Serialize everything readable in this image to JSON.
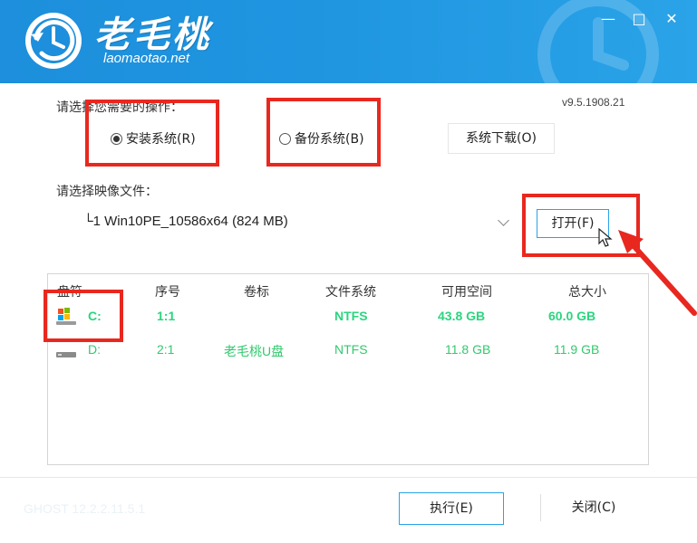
{
  "header": {
    "brand_name": "老毛桃",
    "brand_url": "laomaotao.net",
    "window_buttons": {
      "minimize": "—",
      "maximize": "□",
      "close": "✕"
    }
  },
  "operation": {
    "label": "请选择您需要的操作：",
    "version": "v9.5.1908.21",
    "install_label": "安装系统(R)",
    "install_checked": true,
    "backup_label": "备份系统(B)",
    "download_label": "系统下载(O)"
  },
  "image_file": {
    "label": "请选择映像文件：",
    "selected": "└1 Win10PE_10586x64 (824 MB)",
    "open_label": "打开(F)"
  },
  "partition_table": {
    "columns": [
      "盘符",
      "序号",
      "卷标",
      "文件系统",
      "可用空间",
      "总大小"
    ],
    "rows": [
      {
        "drive": "C:",
        "index": "1:1",
        "volume": "",
        "fs": "NTFS",
        "free": "43.8 GB",
        "total": "60.0 GB",
        "icon": "windows-drive-icon"
      },
      {
        "drive": "D:",
        "index": "2:1",
        "volume": "老毛桃U盘",
        "fs": "NTFS",
        "free": "11.8 GB",
        "total": "11.9 GB",
        "icon": "drive-icon"
      }
    ]
  },
  "footer": {
    "ghost_text": "GHOST 12.2.2.11.5.1",
    "execute_label": "执行(E)",
    "close_label": "关闭(C)"
  },
  "colors": {
    "header_blue": "#1f95e0",
    "accent_green": "#2bd57e",
    "annotation_red": "#e8281f",
    "button_border": "#2aa3e8"
  }
}
